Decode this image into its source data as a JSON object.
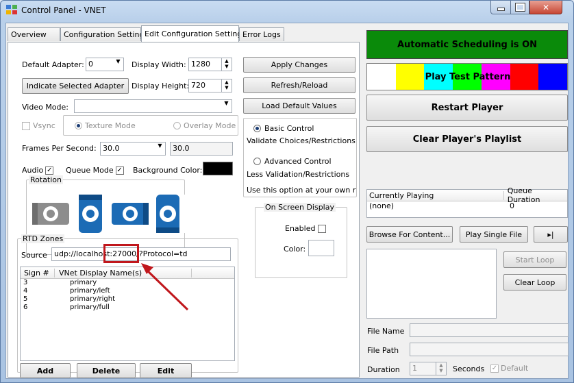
{
  "window": {
    "title": "Control Panel - VNET"
  },
  "tabs": [
    {
      "label": "Overview"
    },
    {
      "label": "Configuration Settings"
    },
    {
      "label": "Edit Configuration Settings"
    },
    {
      "label": "Error Logs"
    }
  ],
  "settings": {
    "default_adapter_label": "Default Adapter:",
    "default_adapter_value": "0",
    "display_width_label": "Display Width:",
    "display_width_value": "1280",
    "indicate_adapter_button": "Indicate Selected Adapter",
    "display_height_label": "Display Height:",
    "display_height_value": "720",
    "video_mode_label": "Video Mode:",
    "video_mode_value": "",
    "vsync_label": "Vsync",
    "texture_mode_label": "Texture Mode",
    "overlay_mode_label": "Overlay Mode",
    "fps_label": "Frames Per Second:",
    "fps_value": "30.0",
    "fps_readout": "30.0",
    "audio_label": "Audio",
    "queue_mode_label": "Queue Mode",
    "background_color_label": "Background Color:",
    "background_color": "#000000",
    "rotation_label": "Rotation"
  },
  "actions": {
    "apply": "Apply Changes",
    "refresh": "Refresh/Reload",
    "load_defaults": "Load Default Values"
  },
  "control_mode": {
    "basic_label": "Basic Control",
    "basic_desc": "Validate Choices/Restrictions",
    "advanced_label": "Advanced Control",
    "advanced_desc": "Less Validation/Restrictions",
    "warning": "Use this option at your own risk"
  },
  "osd": {
    "title": "On Screen Display",
    "enabled_label": "Enabled",
    "color_label": "Color:"
  },
  "rtd": {
    "title": "RTD Zones",
    "source_label": "Source",
    "source_value": "udp://localhost:27000/?Protocol=td",
    "columns": [
      "Sign #",
      "VNet Display Name(s)"
    ],
    "rows": [
      {
        "sign": "3",
        "name": "primary"
      },
      {
        "sign": "4",
        "name": "primary/left"
      },
      {
        "sign": "5",
        "name": "primary/right"
      },
      {
        "sign": "6",
        "name": "primary/full"
      }
    ],
    "add_button": "Add",
    "delete_button": "Delete",
    "edit_button": "Edit"
  },
  "player": {
    "status": "Automatic Scheduling is ON",
    "status_color": "#0a8a0a",
    "test_pattern_button": "Play Test Pattern",
    "test_pattern_colors": [
      "#ffffff",
      "#ffff00",
      "#00ffff",
      "#00ff00",
      "#ff00ff",
      "#ff0000",
      "#0000ff"
    ],
    "restart_button": "Restart Player",
    "clear_playlist_button": "Clear Player's Playlist",
    "currently_playing_header": "Currently Playing",
    "queue_duration_header": "Queue Duration",
    "currently_playing_value": "(none)",
    "queue_duration_value": "0",
    "browse_button": "Browse For Content...",
    "play_single_button": "Play Single File",
    "next_button": "▸|",
    "start_loop_button": "Start Loop",
    "clear_loop_button": "Clear Loop",
    "file_name_label": "File Name",
    "file_path_label": "File Path",
    "duration_label": "Duration",
    "duration_value": "1",
    "seconds_label": "Seconds",
    "default_label": "Default"
  },
  "annotation_color": "#c0171c"
}
